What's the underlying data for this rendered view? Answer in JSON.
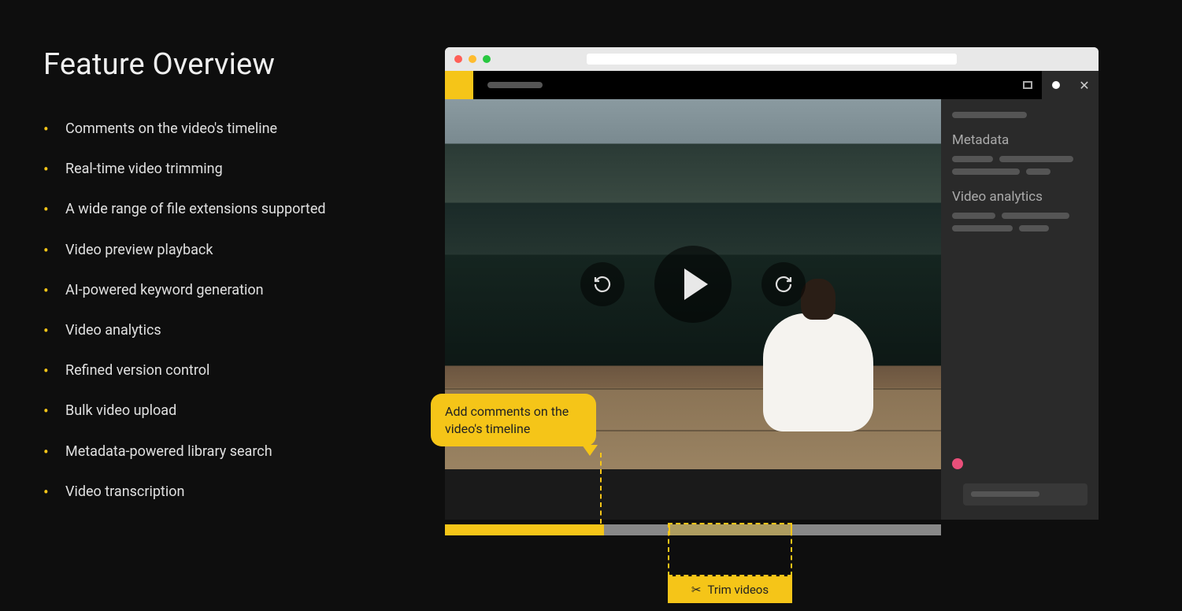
{
  "heading": "Feature Overview",
  "features": [
    "Comments on the video's timeline",
    "Real-time video trimming",
    "A wide range of file extensions supported",
    "Video preview playback",
    "AI-powered keyword generation",
    "Video analytics",
    "Refined version control",
    "Bulk video upload",
    "Metadata-powered library search",
    "Video transcription"
  ],
  "callout": {
    "comment": "Add comments on the video's timeline",
    "trim": "Trim videos"
  },
  "sidebar": {
    "metadata_heading": "Metadata",
    "analytics_heading": "Video analytics"
  },
  "icons": {
    "scissors": "✂"
  },
  "colors": {
    "accent": "#f5c518",
    "background": "#0e0e0e",
    "pink": "#e94f7a"
  }
}
